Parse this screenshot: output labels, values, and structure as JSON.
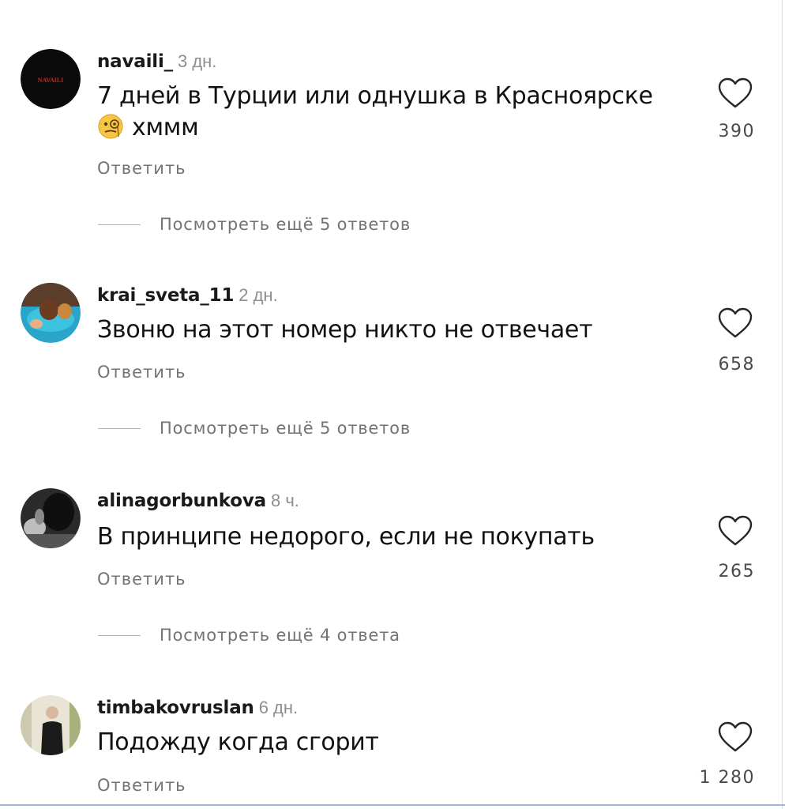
{
  "comments": [
    {
      "username": "navaili_",
      "time": "3 дн.",
      "text": "7 дней в Турции или однушка в Красноярске",
      "text_line2": "хммм",
      "emoji": "thinking-monocle-emoji",
      "reply": "Ответить",
      "view_more": "Посмотреть ещё 5 ответов",
      "likes": "390",
      "avatar_label": "NAVAILI"
    },
    {
      "username": "krai_sveta_11",
      "time": "2 дн.",
      "text": "Звоню на этот номер никто не отвечает",
      "reply": "Ответить",
      "view_more": "Посмотреть ещё 5 ответов",
      "likes": "658"
    },
    {
      "username": "alinagorbunkova",
      "time": "8 ч.",
      "text": "В принципе недорого, если не покупать",
      "reply": "Ответить",
      "view_more": "Посмотреть ещё 4 ответа",
      "likes": "265"
    },
    {
      "username": "timbakovruslan",
      "time": "6 дн.",
      "text": "Подожду когда сгорит",
      "reply": "Ответить",
      "likes": "1 280"
    }
  ],
  "icons": {
    "like": "heart-outline-icon"
  },
  "colors": {
    "username": "#1a1a1a",
    "secondary": "#737373",
    "time": "#8e8e8e",
    "bottom_line": "#9fb4d4"
  }
}
